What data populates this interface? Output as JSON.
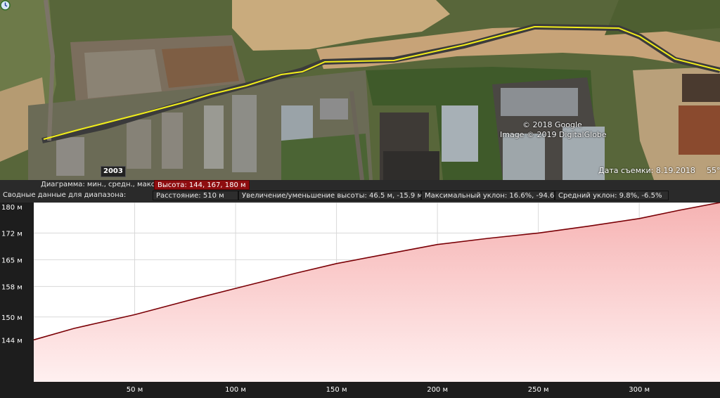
{
  "map": {
    "copyright_lines": [
      "© 2018 Google",
      "Image © 2019 DigitalGlobe"
    ],
    "imagery_year": "2003",
    "capture_date": "Дата съемки: 8.19.2018",
    "coordinate_fragment": "55°",
    "colors": {
      "path": "#f2ee1a",
      "road": "#3b3b3b"
    }
  },
  "stats": {
    "row1_label": "Диаграмма: мин., средн., макс.:",
    "elevation": "Высота: 144, 167, 180 м",
    "row2_label": "Сводные данные для диапазона:",
    "distance": "Расстояние: 510 м",
    "gain_loss": "Увеличение/уменьшение высоты: 46.5 м, -15.9 м",
    "max_slope": "Максимальный уклон: 16.6%, -94.6%",
    "avg_slope": "Средний уклон: 9.8%, -6.5%"
  },
  "chart_data": {
    "type": "area",
    "x_unit": "м",
    "y_unit": "м",
    "xlim": [
      0,
      340
    ],
    "ylim": [
      133,
      180
    ],
    "y_ticks": [
      "144 м",
      "150 м",
      "158 м",
      "165 м",
      "172 м",
      "180 м"
    ],
    "x_ticks": [
      "50 м",
      "100 м",
      "150 м",
      "200 м",
      "250 м",
      "300 м"
    ],
    "x": [
      0,
      20,
      50,
      80,
      100,
      130,
      150,
      175,
      200,
      225,
      250,
      275,
      300,
      320,
      340
    ],
    "y": [
      144.0,
      147.0,
      150.6,
      154.8,
      157.5,
      161.5,
      164.0,
      166.5,
      169.0,
      170.6,
      172.0,
      173.8,
      175.8,
      178.0,
      180.0
    ],
    "colors": {
      "line": "#7a0006",
      "fill_top": "#f6b3b3",
      "fill_bottom": "#fff0f0",
      "grid": "#d8d8d8"
    }
  }
}
